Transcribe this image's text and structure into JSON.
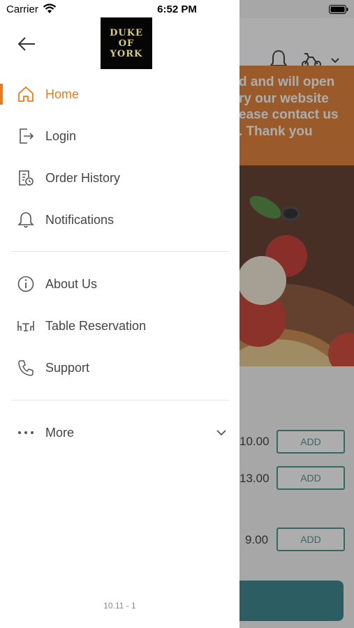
{
  "status_bar": {
    "carrier": "Carrier",
    "time": "6:52 PM"
  },
  "drawer": {
    "logo_lines": [
      "DUKE",
      "OF",
      "YORK"
    ],
    "menu": [
      {
        "label": "Home",
        "icon": "home-icon",
        "active": true
      },
      {
        "label": "Login",
        "icon": "login-icon"
      },
      {
        "label": "Order History",
        "icon": "order-history-icon"
      },
      {
        "label": "Notifications",
        "icon": "bell-icon"
      }
    ],
    "menu2": [
      {
        "label": "About Us",
        "icon": "info-icon"
      },
      {
        "label": "Table Reservation",
        "icon": "table-reservation-icon"
      },
      {
        "label": "Support",
        "icon": "phone-icon"
      }
    ],
    "more": {
      "label": "More",
      "icon": "more-dots-icon"
    },
    "version": "10.11 - 1"
  },
  "background": {
    "banner_lines": [
      "d and will open",
      "ry our website",
      "ease contact us",
      ". Thank you"
    ],
    "items": [
      {
        "price": "10.00",
        "add_label": "ADD"
      },
      {
        "price": "13.00",
        "add_label": "ADD"
      },
      {
        "price": "9.00",
        "add_label": "ADD"
      }
    ]
  },
  "colors": {
    "accent": "#e87a1f",
    "banner": "#e07a2b",
    "teal": "#3f8f88"
  }
}
